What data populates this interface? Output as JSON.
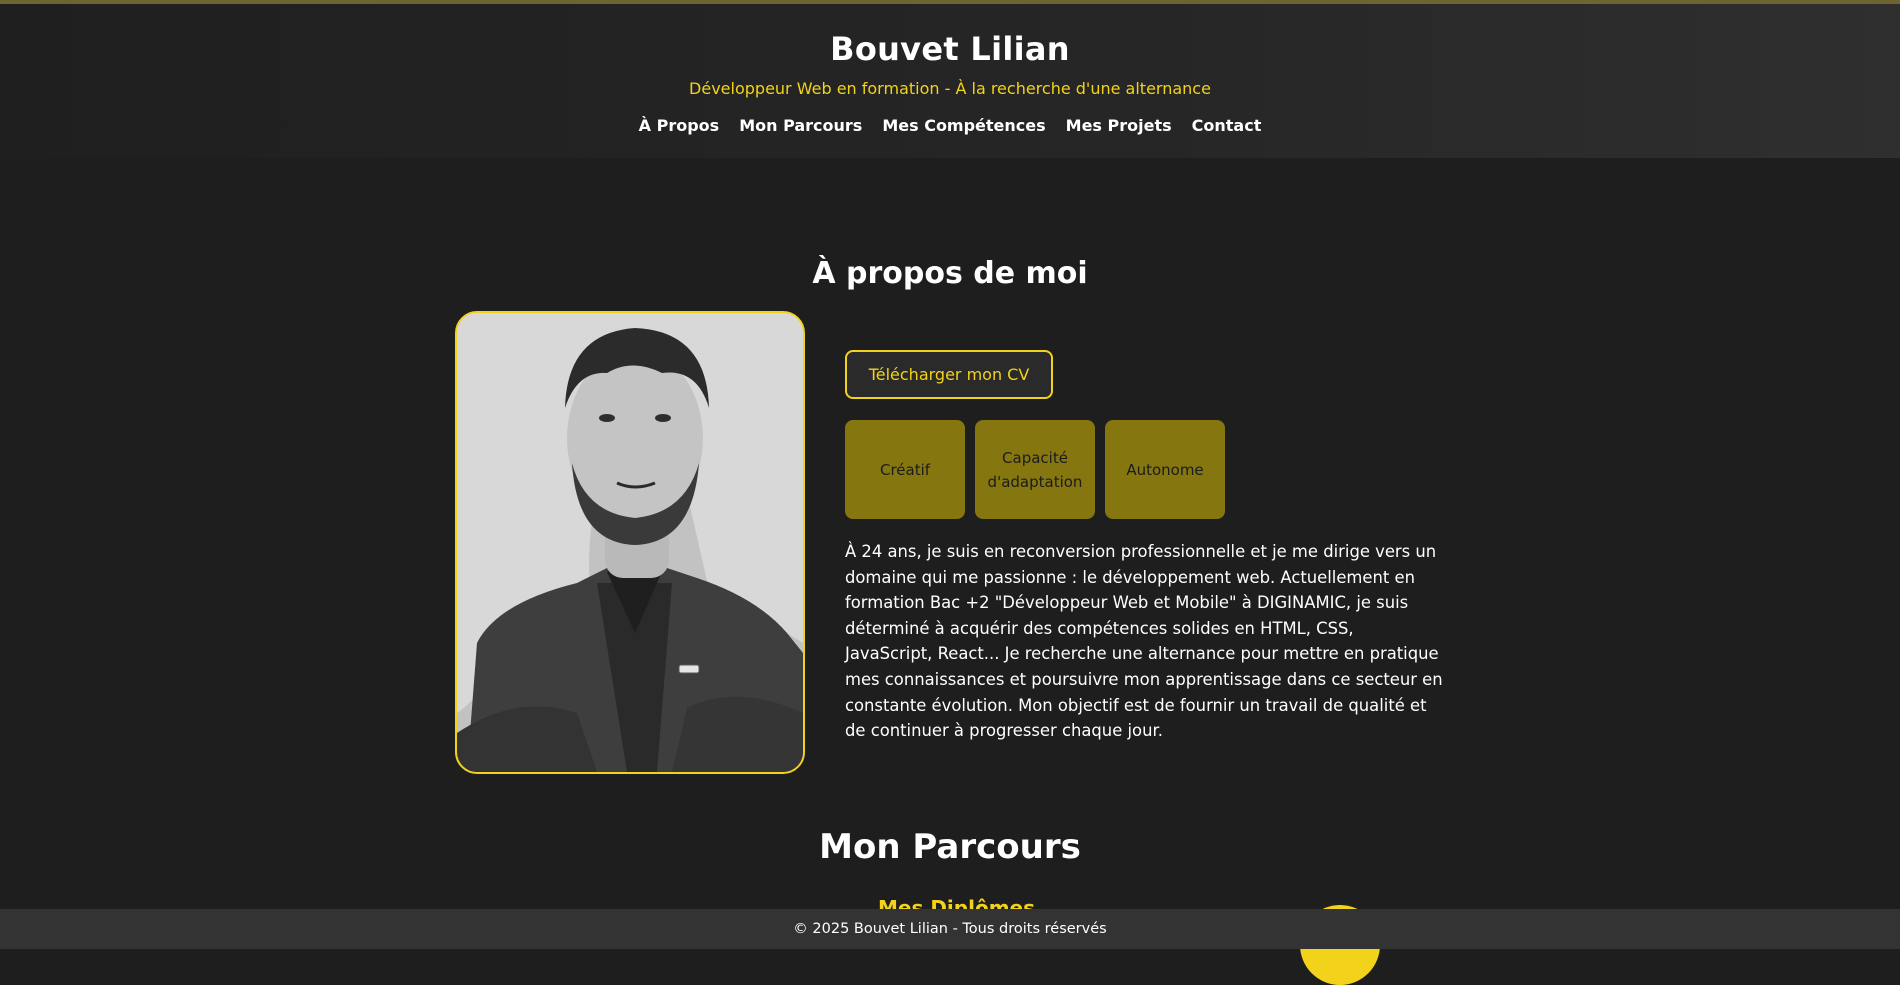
{
  "header": {
    "title": "Bouvet Lilian",
    "subtitle": "Développeur Web en formation - À la recherche d'une alternance",
    "nav": [
      "À Propos",
      "Mon Parcours",
      "Mes Compétences",
      "Mes Projets",
      "Contact"
    ]
  },
  "about": {
    "title": "À propos de moi",
    "cv_button": "Télécharger mon CV",
    "traits": [
      "Créatif",
      "Capacité d'adaptation",
      "Autonome"
    ],
    "bio": "À 24 ans, je suis en reconversion professionnelle et je me dirige vers un domaine qui me passionne : le développement web. Actuellement en formation Bac +2 \"Développeur Web et Mobile\" à DIGINAMIC, je suis déterminé à acquérir des compétences solides en HTML, CSS, JavaScript, React... Je recherche une alternance pour mettre en pratique mes connaissances et poursuivre mon apprentissage dans ce secteur en constante évolution. Mon objectif est de fournir un travail de qualité et de continuer à progresser chaque jour."
  },
  "parcours": {
    "title": "Mon Parcours",
    "diplomes": "Mes Diplômes"
  },
  "footer": {
    "text": "© 2025 Bouvet Lilian - Tous droits réservés"
  },
  "colors": {
    "accent": "#f2d21b",
    "trait_bg": "#857610",
    "background": "#1e1e1e"
  }
}
